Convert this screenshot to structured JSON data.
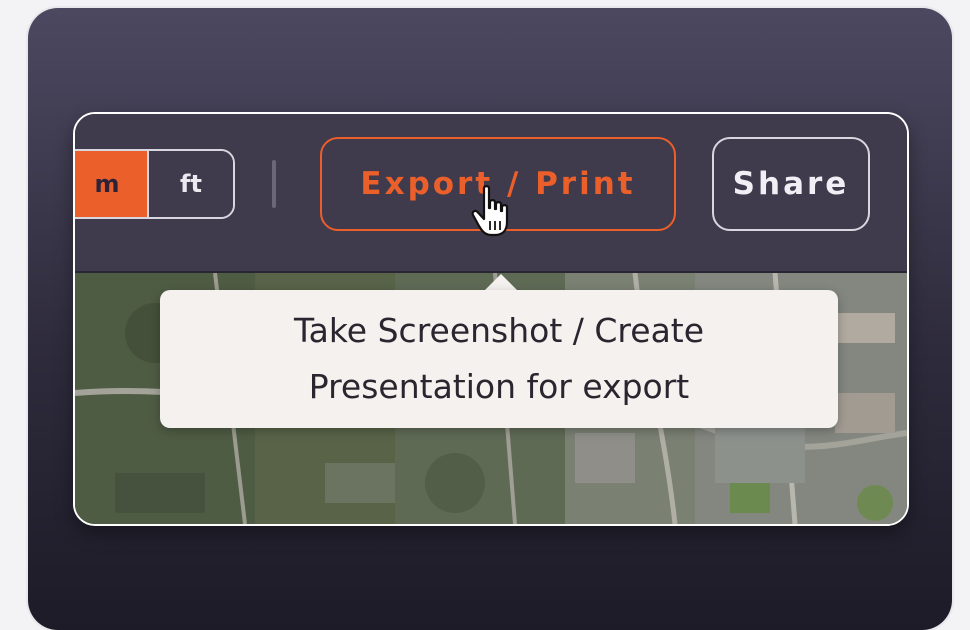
{
  "toolbar": {
    "units": {
      "metric_label": "m",
      "imperial_label": "ft",
      "selected": "m"
    },
    "export_button_label": "Export / Print",
    "share_button_label": "Share"
  },
  "tooltip": {
    "line1": "Take Screenshot / Create",
    "line2": "Presentation for export"
  },
  "icons": {
    "cursor": "hand-pointer-icon"
  },
  "colors": {
    "accent": "#ea5f2a",
    "toolbar_bg": "#3f3a4c",
    "tooltip_bg": "#f4f1ee"
  }
}
